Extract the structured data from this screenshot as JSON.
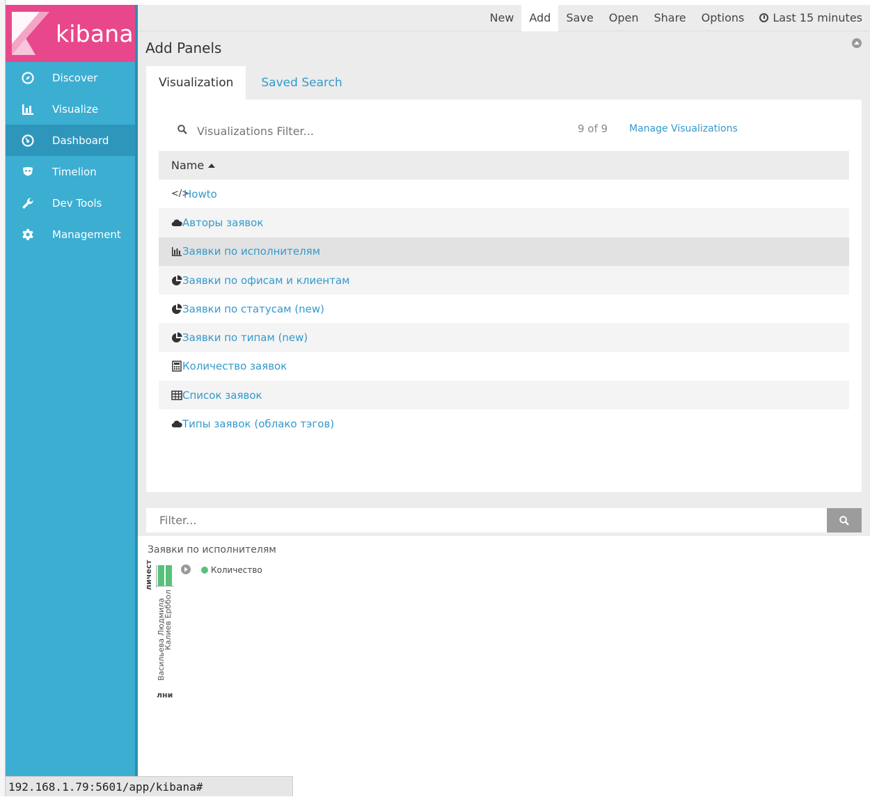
{
  "app": {
    "logo_text": "kibana",
    "brand_color": "#e8488b",
    "sidebar_color": "#3caed2"
  },
  "sidebar": {
    "items": [
      {
        "label": "Discover",
        "icon": "compass-icon"
      },
      {
        "label": "Visualize",
        "icon": "bar-chart-icon"
      },
      {
        "label": "Dashboard",
        "icon": "dashboard-gauge-icon",
        "active": true
      },
      {
        "label": "Timelion",
        "icon": "timelion-mask-icon"
      },
      {
        "label": "Dev Tools",
        "icon": "wrench-icon"
      },
      {
        "label": "Management",
        "icon": "gear-icon"
      }
    ]
  },
  "topmenu": {
    "new": "New",
    "add": "Add",
    "save": "Save",
    "open": "Open",
    "share": "Share",
    "options": "Options",
    "timepicker": "Last 15 minutes"
  },
  "add_panels": {
    "title": "Add Panels",
    "tabs": [
      "Visualization",
      "Saved Search"
    ],
    "filter_placeholder": "Visualizations Filter...",
    "count": "9 of 9",
    "manage_link": "Manage Visualizations",
    "column_header": "Name",
    "items": [
      {
        "label": "Howto",
        "icon": "code-icon"
      },
      {
        "label": "Авторы заявок",
        "icon": "cloud-icon"
      },
      {
        "label": "Заявки по исполнителям",
        "icon": "bar-chart-icon"
      },
      {
        "label": "Заявки по офисам и клиентам",
        "icon": "pie-chart-icon"
      },
      {
        "label": "Заявки по статусам (new)",
        "icon": "pie-chart-icon"
      },
      {
        "label": "Заявки по типам (new)",
        "icon": "pie-chart-icon"
      },
      {
        "label": "Количество заявок",
        "icon": "calculator-icon"
      },
      {
        "label": "Список заявок",
        "icon": "table-icon"
      },
      {
        "label": "Типы заявок (облако тэгов)",
        "icon": "cloud-icon"
      }
    ]
  },
  "filter": {
    "placeholder": "Filter..."
  },
  "visualization": {
    "title": "Заявки по исполнителям",
    "legend_label": "Количество",
    "legend_color": "#57c17b",
    "y_label": "личест",
    "x_label": "лни",
    "categories": [
      "Васильева Людмила",
      "Калиев Ерббол"
    ],
    "bar_color": "#57c17b"
  },
  "statusbar": {
    "url": "192.168.1.79:5601/app/kibana#"
  }
}
